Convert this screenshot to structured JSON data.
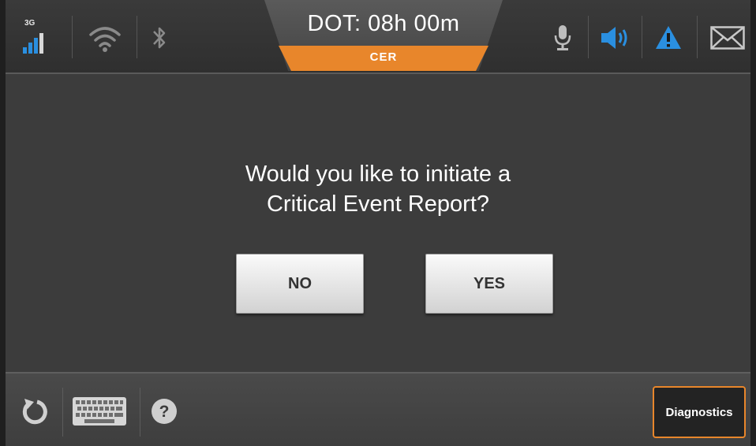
{
  "status_bar": {
    "network_type": "3G",
    "signal_icon": "cell-signal-icon",
    "wifi_icon": "wifi-icon",
    "bluetooth_icon": "bluetooth-icon",
    "dot_label": "DOT: 08h 00m",
    "mode_label": "CER",
    "mic_icon": "microphone-icon",
    "speaker_icon": "speaker-icon",
    "warning_icon": "warning-icon",
    "mail_icon": "mail-icon"
  },
  "dialog": {
    "question_line1": "Would you like to initiate a",
    "question_line2": "Critical Event Report?",
    "no_label": "NO",
    "yes_label": "YES"
  },
  "bottom_bar": {
    "refresh_icon": "refresh-icon",
    "keyboard_icon": "keyboard-icon",
    "help_icon": "help-icon",
    "diagnostics_label": "Diagnostics"
  },
  "colors": {
    "accent_orange": "#e8862b",
    "accent_blue": "#2a8fe0",
    "background": "#3c3c3c"
  }
}
